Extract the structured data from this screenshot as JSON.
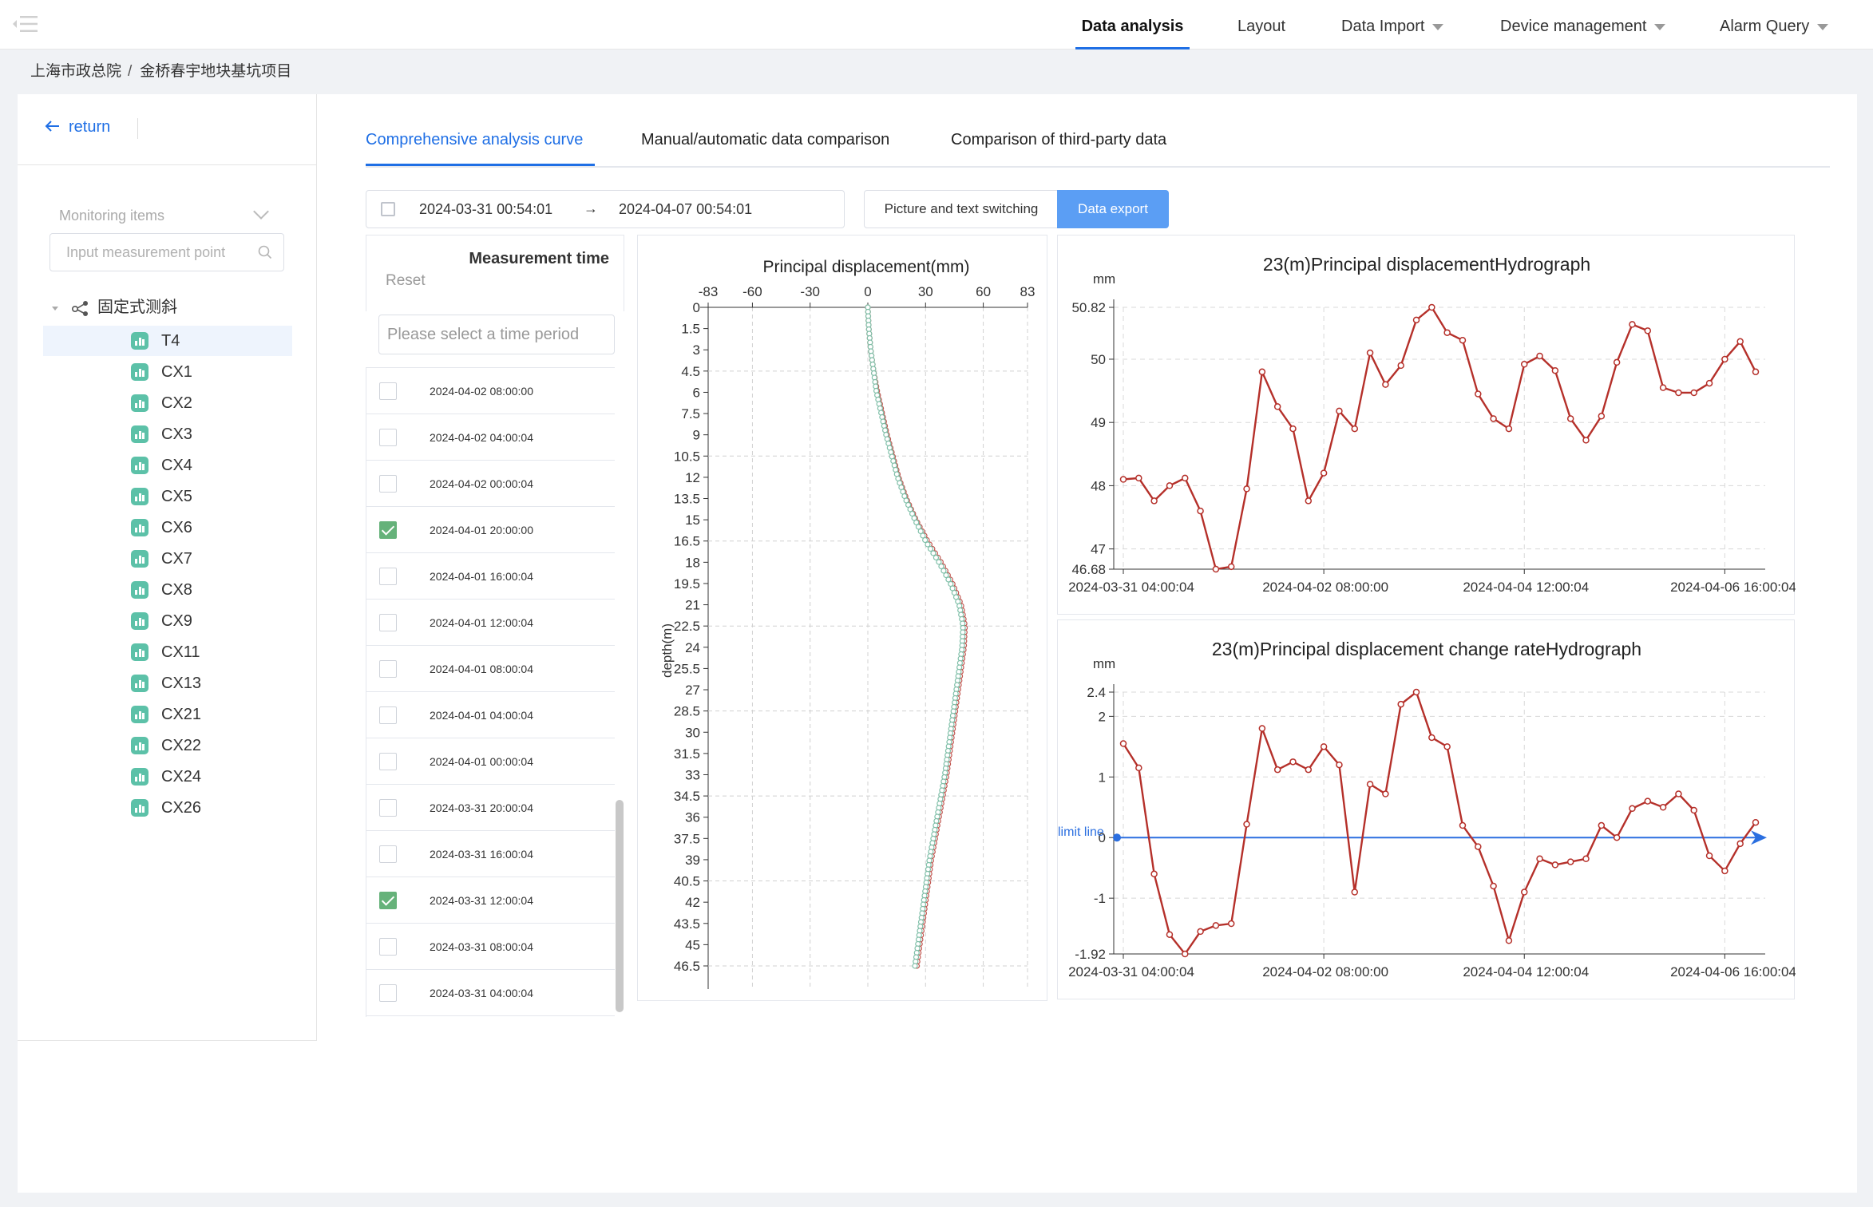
{
  "nav": {
    "items": [
      {
        "label": "Data analysis",
        "active": true,
        "dropdown": false
      },
      {
        "label": "Layout",
        "active": false,
        "dropdown": false
      },
      {
        "label": "Data Import",
        "active": false,
        "dropdown": true
      },
      {
        "label": "Device management",
        "active": false,
        "dropdown": true
      },
      {
        "label": "Alarm Query",
        "active": false,
        "dropdown": true
      }
    ]
  },
  "breadcrumb": [
    "上海市政总院",
    "金桥春宇地块基坑项目"
  ],
  "breadcrumb_sep": "/",
  "sidebar": {
    "return_label": "return",
    "monitoring_placeholder": "Monitoring items",
    "search_placeholder": "Input measurement point",
    "tree_root": "固定式测斜",
    "points": [
      "T4",
      "CX1",
      "CX2",
      "CX3",
      "CX4",
      "CX5",
      "CX6",
      "CX7",
      "CX8",
      "CX9",
      "CX11",
      "CX13",
      "CX21",
      "CX22",
      "CX24",
      "CX26"
    ],
    "selected": "T4"
  },
  "tabs": [
    "Comprehensive analysis curve",
    "Manual/automatic data comparison",
    "Comparison of third-party data"
  ],
  "active_tab": 0,
  "date_range": {
    "start": "2024-03-31 00:54:01",
    "end": "2024-04-07 00:54:01",
    "arrow": "→"
  },
  "buttons": {
    "switch": "Picture and text switching",
    "export": "Data export"
  },
  "time_panel": {
    "reset": "Reset",
    "title": "Measurement time",
    "period_placeholder": "Please select a time period",
    "rows": [
      {
        "time": "2024-04-02 08:00:00",
        "checked": false
      },
      {
        "time": "2024-04-02 04:00:04",
        "checked": false
      },
      {
        "time": "2024-04-02 00:00:04",
        "checked": false
      },
      {
        "time": "2024-04-01 20:00:00",
        "checked": true
      },
      {
        "time": "2024-04-01 16:00:04",
        "checked": false
      },
      {
        "time": "2024-04-01 12:00:04",
        "checked": false
      },
      {
        "time": "2024-04-01 08:00:04",
        "checked": false
      },
      {
        "time": "2024-04-01 04:00:04",
        "checked": false
      },
      {
        "time": "2024-04-01 00:00:04",
        "checked": false
      },
      {
        "time": "2024-03-31 20:00:04",
        "checked": false
      },
      {
        "time": "2024-03-31 16:00:04",
        "checked": false
      },
      {
        "time": "2024-03-31 12:00:04",
        "checked": true
      },
      {
        "time": "2024-03-31 08:00:04",
        "checked": false
      },
      {
        "time": "2024-03-31 04:00:04",
        "checked": false
      }
    ]
  },
  "colors": {
    "accent": "#1f6fe5",
    "export_button": "#5b9ef4",
    "series_red": "#b5302a",
    "series_green": "#7fbfa8",
    "baseline": "#2b6fe0",
    "tree_icon": "#5cc1a8"
  },
  "chart_data": [
    {
      "type": "line",
      "title": "Principal displacement(mm)",
      "ylabel": "depth(m)",
      "orientation": "vertical-profile",
      "xlim": [
        -83,
        83
      ],
      "xticks": [
        -83,
        -60,
        -30,
        0,
        30,
        60,
        83
      ],
      "yticks": [
        0,
        1.5,
        3,
        4.5,
        6,
        7.5,
        9,
        10.5,
        12,
        13.5,
        15,
        16.5,
        18,
        19.5,
        21,
        22.5,
        24,
        25.5,
        27,
        28.5,
        30,
        31.5,
        33,
        34.5,
        36,
        37.5,
        39,
        40.5,
        42,
        43.5,
        45,
        46.5
      ],
      "ylim": [
        0,
        46.5
      ],
      "series": [
        {
          "color": "red",
          "depth": [
            0,
            1.5,
            3,
            4.5,
            6,
            7.5,
            9,
            10.5,
            12,
            13.5,
            15,
            16.5,
            18,
            19.5,
            21,
            22.5,
            24,
            25.5,
            27,
            28.5,
            30,
            31.5,
            33,
            34.5,
            36,
            37.5,
            39,
            40.5,
            42,
            43.5,
            45,
            46.5
          ],
          "values": [
            0,
            0.5,
            1.5,
            3,
            5,
            7.5,
            10,
            13,
            16,
            20,
            25,
            31,
            38,
            44,
            48.5,
            50.5,
            50,
            48.5,
            47,
            45.5,
            44,
            42.5,
            41,
            39,
            37,
            35,
            33,
            31.5,
            30,
            28.5,
            27,
            25.5
          ]
        },
        {
          "color": "green",
          "depth": [
            0,
            1.5,
            3,
            4.5,
            6,
            7.5,
            9,
            10.5,
            12,
            13.5,
            15,
            16.5,
            18,
            19.5,
            21,
            22.5,
            24,
            25.5,
            27,
            28.5,
            30,
            31.5,
            33,
            34.5,
            36,
            37.5,
            39,
            40.5,
            42,
            43.5,
            45,
            46.5
          ],
          "values": [
            0,
            0.5,
            1.5,
            3,
            4.5,
            7,
            9.5,
            12.5,
            15.5,
            19.5,
            24.5,
            30,
            37,
            43,
            47.5,
            49.5,
            49,
            47.5,
            46,
            44.5,
            43,
            41.5,
            40,
            38,
            36,
            34,
            32,
            30.5,
            29,
            27.5,
            26,
            24.5
          ]
        }
      ]
    },
    {
      "type": "line",
      "title": "23(m)Principal displacementHydrograph",
      "ylabel": "mm",
      "ylim": [
        46.68,
        50.82
      ],
      "yticks": [
        46.68,
        47,
        48,
        49,
        50,
        50.82
      ],
      "xtick_labels": [
        "2024-03-31 04:00:04",
        "2024-04-02 08:00:00",
        "2024-04-04 12:00:04",
        "2024-04-06 16:00:04"
      ],
      "x": [
        0,
        1,
        2,
        3,
        4,
        5,
        6,
        7,
        8,
        9,
        10,
        11,
        12,
        13,
        14,
        15,
        16,
        17,
        18,
        19,
        20,
        21,
        22,
        23,
        24,
        25,
        26,
        27,
        28,
        29,
        30,
        31,
        32,
        33,
        34,
        35,
        36,
        37,
        38,
        39,
        40,
        41
      ],
      "xtick_positions": [
        0,
        13,
        26,
        39
      ],
      "values": [
        48.1,
        48.12,
        47.76,
        48.0,
        48.12,
        47.6,
        46.68,
        46.72,
        47.95,
        49.8,
        49.25,
        48.9,
        47.76,
        48.2,
        49.18,
        48.9,
        50.1,
        49.6,
        49.9,
        50.62,
        50.82,
        50.42,
        50.3,
        49.45,
        49.06,
        48.9,
        49.92,
        50.05,
        49.82,
        49.06,
        48.72,
        49.1,
        49.95,
        50.55,
        50.45,
        49.55,
        49.47,
        49.47,
        49.62,
        50.0,
        50.28,
        49.8
      ]
    },
    {
      "type": "line",
      "title": "23(m)Principal displacement change rateHydrograph",
      "ylabel": "mm",
      "ylim": [
        -1.92,
        2.4
      ],
      "yticks": [
        -1.92,
        -1,
        0,
        1,
        2,
        2.4
      ],
      "xtick_labels": [
        "2024-03-31 04:00:04",
        "2024-04-02 08:00:00",
        "2024-04-04 12:00:04",
        "2024-04-06 16:00:04"
      ],
      "x": [
        0,
        1,
        2,
        3,
        4,
        5,
        6,
        7,
        8,
        9,
        10,
        11,
        12,
        13,
        14,
        15,
        16,
        17,
        18,
        19,
        20,
        21,
        22,
        23,
        24,
        25,
        26,
        27,
        28,
        29,
        30,
        31,
        32,
        33,
        34,
        35,
        36,
        37,
        38,
        39,
        40,
        41
      ],
      "xtick_positions": [
        0,
        13,
        26,
        39
      ],
      "values": [
        1.55,
        1.15,
        -0.6,
        -1.6,
        -1.92,
        -1.55,
        -1.45,
        -1.42,
        0.22,
        1.8,
        1.12,
        1.25,
        1.12,
        1.5,
        1.2,
        -0.9,
        0.88,
        0.72,
        2.2,
        2.4,
        1.65,
        1.5,
        0.2,
        -0.15,
        -0.8,
        -1.7,
        -0.9,
        -0.35,
        -0.45,
        -0.4,
        -0.35,
        0.2,
        0.0,
        0.48,
        0.6,
        0.5,
        0.72,
        0.45,
        -0.3,
        -0.55,
        -0.1,
        0.25
      ],
      "baseline": {
        "value": 0,
        "label": "limit line"
      }
    }
  ]
}
